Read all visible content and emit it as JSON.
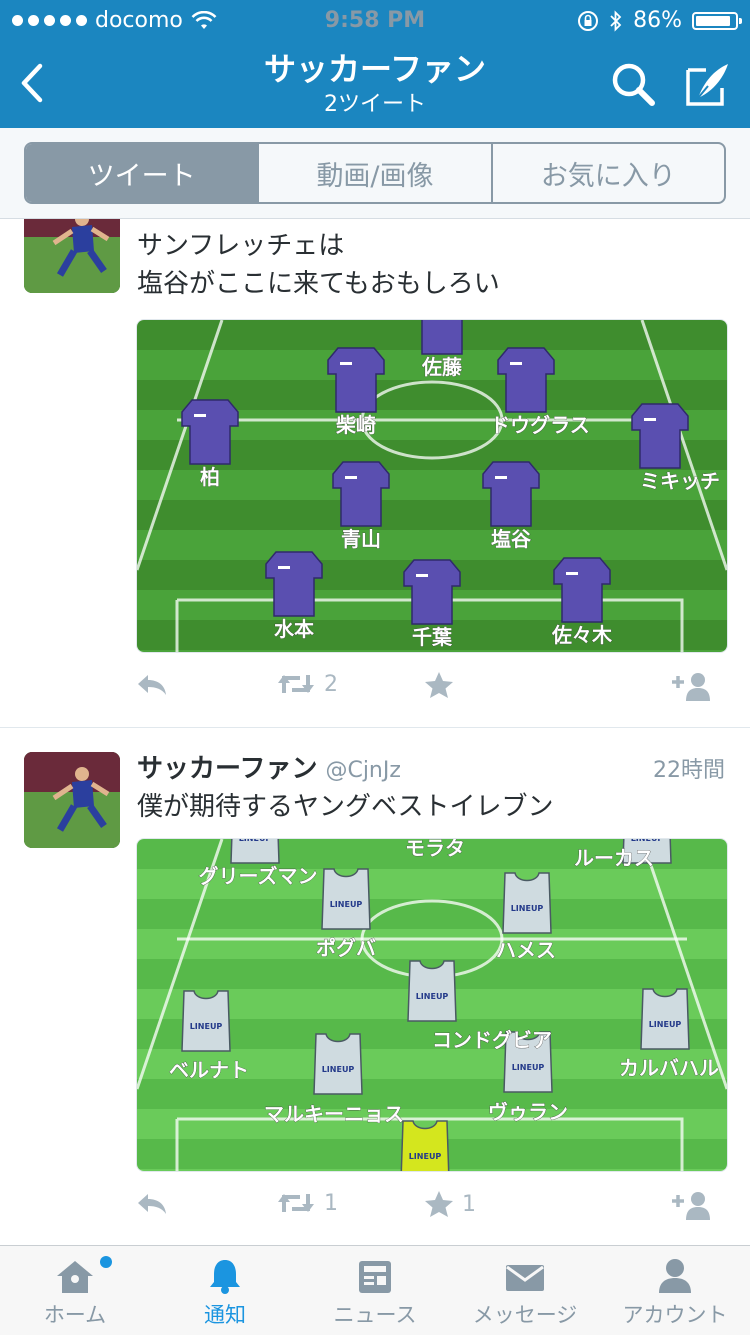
{
  "status_bar": {
    "carrier": "docomo",
    "time": "9:58 PM",
    "battery_pct": "86%",
    "battery_level": 0.86
  },
  "nav": {
    "title": "サッカーファン",
    "subtitle": "2ツイート"
  },
  "segments": [
    "ツイート",
    "動画/画像",
    "お気に入り"
  ],
  "tweets": [
    {
      "text_lines": [
        "サンフレッチェは",
        "塩谷がここに来てもおもしろい"
      ],
      "media_labels": [
        "佐藤",
        "柴崎",
        "ドウグラス",
        "柏",
        "ミキッチ",
        "青山",
        "塩谷",
        "水本",
        "千葉",
        "佐々木"
      ],
      "retweets": "2",
      "favorites": ""
    },
    {
      "name": "サッカーファン",
      "handle": "@CjnJz",
      "time": "22時間",
      "text_lines": [
        "僕が期待するヤングベストイレブン"
      ],
      "media_labels": [
        "グリーズマン",
        "モラタ",
        "ルーカス",
        "ポグバ",
        "ハメス",
        "コンドグビア",
        "ベルナト",
        "カルバハル",
        "マルキーニョス",
        "ヴゥラン"
      ],
      "bib_label": "LINEUP",
      "retweets": "1",
      "favorites": "1"
    }
  ],
  "tabbar": {
    "items": [
      "ホーム",
      "通知",
      "ニュース",
      "メッセージ",
      "アカウント"
    ],
    "active_index": 1
  },
  "colors": {
    "nav_bg": "#1b86c0",
    "accent": "#1b95e0",
    "gray": "#8899a6",
    "pitch_dark": "#3f8d2e",
    "pitch_light": "#5fc64a",
    "jersey": "#5a4fb0"
  }
}
